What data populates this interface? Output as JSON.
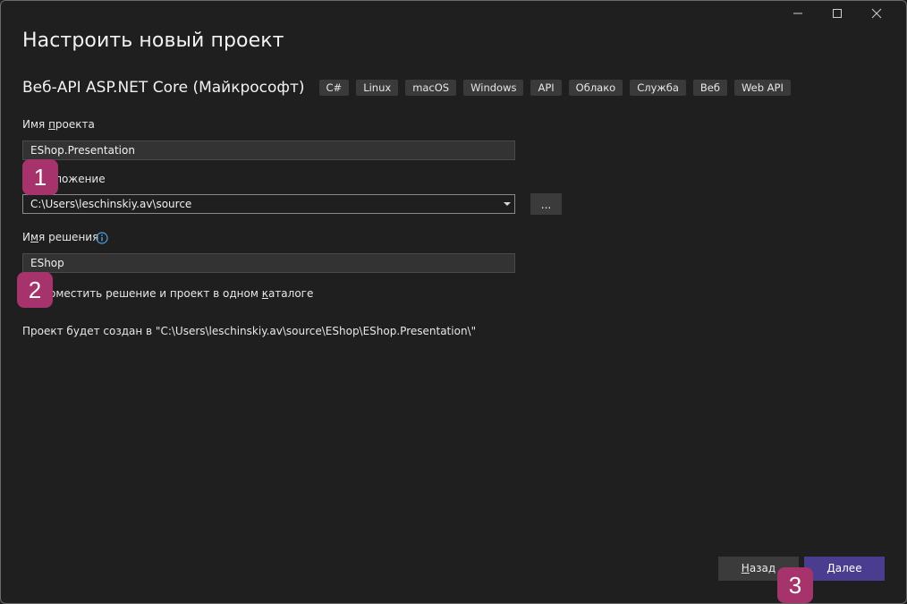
{
  "window": {
    "title": "Настроить новый проект",
    "controls": {
      "minimize_icon": "minimize-icon",
      "maximize_icon": "maximize-icon",
      "close_icon": "close-icon"
    }
  },
  "template": {
    "name": "Веб-API ASP.NET Core (Майкрософт)",
    "tags": [
      "C#",
      "Linux",
      "macOS",
      "Windows",
      "API",
      "Облако",
      "Служба",
      "Веб",
      "Web API"
    ]
  },
  "project_name": {
    "label_prefix": "Имя ",
    "label_underlined": "п",
    "label_rest": "роекта",
    "value": "EShop.Presentation"
  },
  "location": {
    "label": "Расположение",
    "value": "C:\\Users\\leschinskiy.av\\source",
    "browse_label": "..."
  },
  "solution_name": {
    "label_prefix": "И",
    "label_underlined": "м",
    "label_rest": "я решения",
    "value": "EShop"
  },
  "same_dir": {
    "label_prefix": "Поместить решение и проект в одном ",
    "label_underlined": "к",
    "label_rest": "аталоге",
    "checked": false
  },
  "path_info": "Проект будет создан в \"C:\\Users\\leschinskiy.av\\source\\EShop\\EShop.Presentation\\\"",
  "buttons": {
    "back_underlined": "Н",
    "back_rest": "азад",
    "next_underlined": "Д",
    "next_rest": "алее"
  },
  "markers": [
    "1",
    "2",
    "3"
  ],
  "colors": {
    "accent": "#4a3d8f",
    "marker": "#a6336b",
    "background": "#1f1f1f"
  }
}
